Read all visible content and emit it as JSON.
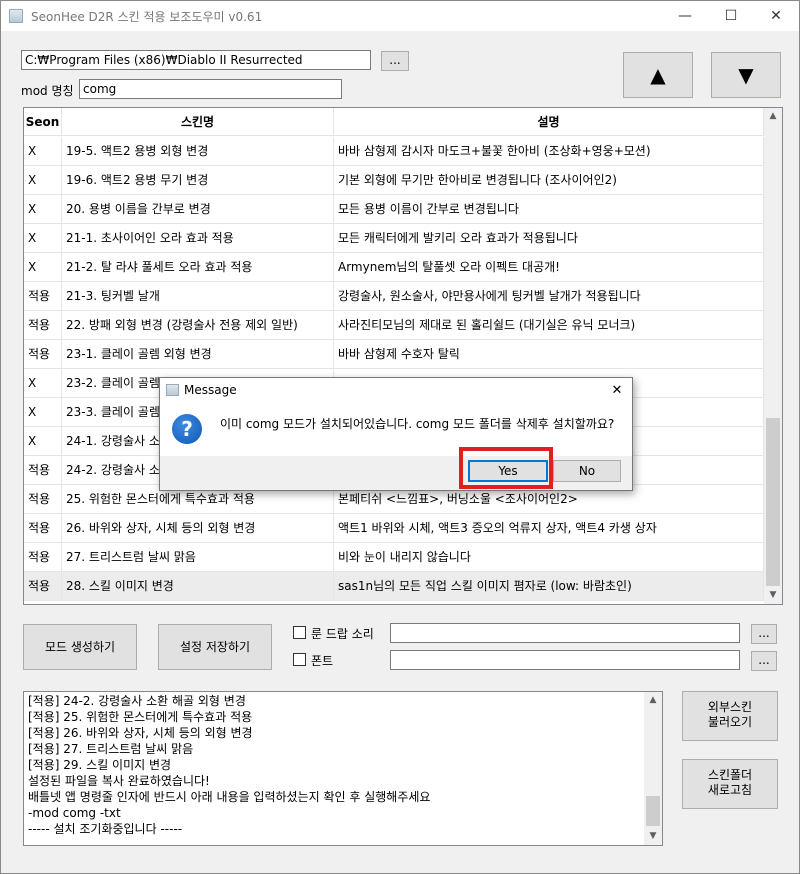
{
  "window": {
    "title": "SeonHee D2R 스킨 적용 보조도우미 v0.61",
    "minimize": "—",
    "maximize": "☐",
    "close": "✕"
  },
  "path": {
    "value": "C:₩Program Files (x86)₩Diablo II Resurrected",
    "browse_label": "..."
  },
  "mod": {
    "label": "mod 명칭",
    "value": "comg"
  },
  "nav": {
    "up_label": "▲",
    "down_label": "▼"
  },
  "grid": {
    "columns": [
      "Seon",
      "스킨명",
      "설명"
    ],
    "rows": [
      {
        "seon": "X",
        "name": "19-5. 액트2 용병 외형 변경",
        "desc": "바바 삼형제 감시자 마도크+불꽃 한아비 (조상화+영웅+모션)"
      },
      {
        "seon": "X",
        "name": "19-6. 액트2 용병 무기 변경",
        "desc": "기본 외형에 무기만 한아비로 변경됩니다 (조사이어인2)"
      },
      {
        "seon": "X",
        "name": "20. 용병 이름을 간부로 변경",
        "desc": "모든 용병 이름이 간부로 변경됩니다"
      },
      {
        "seon": "X",
        "name": "21-1. 초사이어인 오라 효과 적용",
        "desc": "모든 캐릭터에게 발키리 오라 효과가 적용됩니다"
      },
      {
        "seon": "X",
        "name": "21-2. 탈 라샤 풀세트 오라 효과 적용",
        "desc": "Armynem님의 탈풀셋 오라 이펙트 대공개!"
      },
      {
        "seon": "적용",
        "name": "21-3. 팅커벨 날개",
        "desc": "강령술사, 원소술사, 야만용사에게 팅커벨 날개가 적용됩니다"
      },
      {
        "seon": "적용",
        "name": "22. 방패 외형 변경 (강령술사 전용 제외 일반)",
        "desc": "사라진티모님의 제대로 된 홀리쉴드 (대기실은 유닉 모너크)"
      },
      {
        "seon": "적용",
        "name": "23-1. 클레이 골렘 외형 변경",
        "desc": "바바 삼형제 수호자 탈릭"
      },
      {
        "seon": "X",
        "name": "23-2. 클레이 골렘",
        "desc": ""
      },
      {
        "seon": "X",
        "name": "23-3. 클레이 골렘",
        "desc": ""
      },
      {
        "seon": "X",
        "name": "24-1. 강령술사 소",
        "desc": ""
      },
      {
        "seon": "적용",
        "name": "24-2. 강령술사 소",
        "desc": ""
      },
      {
        "seon": "적용",
        "name": "25. 위험한 몬스터에게 특수효과 적용",
        "desc": "본페티쉬 <느낌표>, 버닝소울 <조사이어인2>"
      },
      {
        "seon": "적용",
        "name": "26. 바위와 상자, 시체 등의 외형 변경",
        "desc": "액트1 바위와 시체, 액트3 증오의 억류지 상자, 액트4 카생 상자"
      },
      {
        "seon": "적용",
        "name": "27. 트리스트럼 날씨 맑음",
        "desc": "비와 눈이 내리지 않습니다"
      },
      {
        "seon": "적용",
        "name": "28. 스킬 이미지 변경",
        "desc": "sas1n님의 모든 직업 스킬 이미지 폄자로 (low: 바람초인)"
      }
    ]
  },
  "actions": {
    "create_mod": "모드 생성하기",
    "save_settings": "설정 저장하기",
    "rune_drop_sound": "룬 드랍 소리",
    "font": "폰트",
    "browse": "...",
    "external_skin": [
      "외부스킨",
      "불러오기"
    ],
    "refresh_skin": [
      "스킨폴더",
      "새로고침"
    ]
  },
  "log": {
    "lines": [
      "[적용] 24-2. 강령술사 소환 해골 외형 변경",
      "[적용] 25. 위험한 몬스터에게 특수효과 적용",
      "[적용] 26. 바위와 상자, 시체 등의 외형 변경",
      "[적용] 27. 트리스트럼 날씨 맑음",
      "[적용] 29. 스킬 이미지 변경",
      "설정된 파일을 복사 완료하였습니다!",
      "배틀넷 앱 명령줄 인자에 반드시 아래 내용을 입력하셨는지 확인 후 실행해주세요",
      " -mod comg -txt",
      "----- 설치 조기화중입니다 -----"
    ]
  },
  "dialog": {
    "title": "Message",
    "message": "이미 comg 모드가 설치되어있습니다. comg 모드 폴더를 삭제후 설치할까요?",
    "icon": "?",
    "yes": "Yes",
    "no": "No",
    "close": "✕"
  },
  "colors": {
    "highlight": "#e02020",
    "focus_border": "#0078d7",
    "question_icon": "#0b57b5"
  }
}
